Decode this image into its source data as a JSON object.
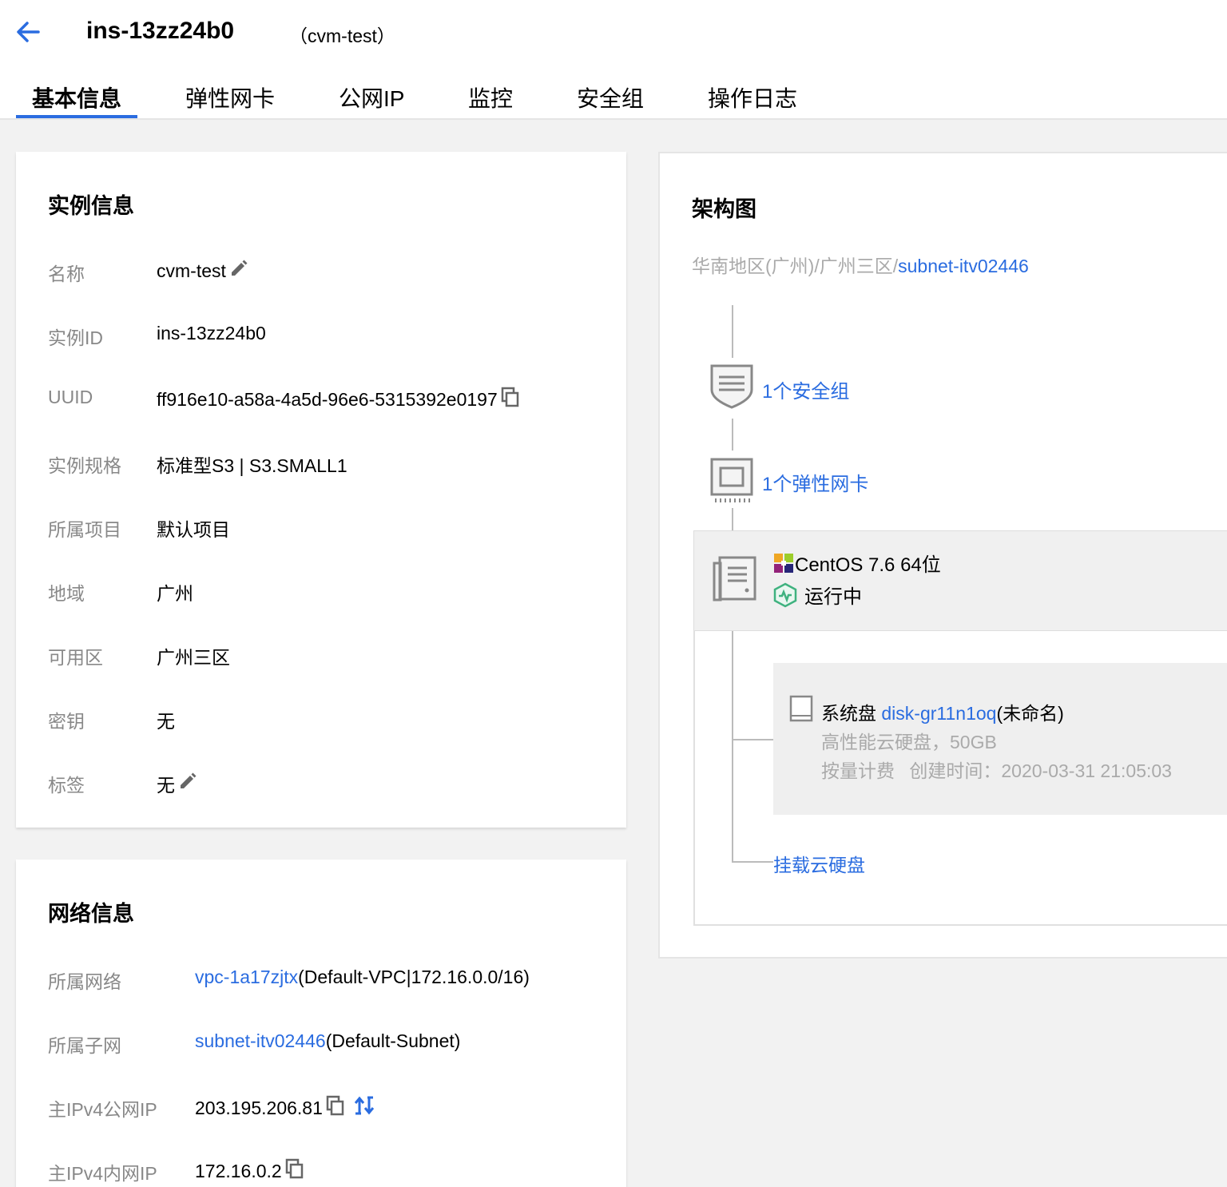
{
  "header": {
    "title": "ins-13zz24b0",
    "alias": "（cvm-test）"
  },
  "tabs": [
    {
      "label": "基本信息",
      "active": true
    },
    {
      "label": "弹性网卡",
      "active": false
    },
    {
      "label": "公网IP",
      "active": false
    },
    {
      "label": "监控",
      "active": false
    },
    {
      "label": "安全组",
      "active": false
    },
    {
      "label": "操作日志",
      "active": false
    }
  ],
  "instance_info": {
    "title": "实例信息",
    "rows": [
      {
        "label": "名称",
        "value": "cvm-test"
      },
      {
        "label": "实例ID",
        "value": "ins-13zz24b0"
      },
      {
        "label": "UUID",
        "value": "ff916e10-a58a-4a5d-96e6-5315392e0197"
      },
      {
        "label": "实例规格",
        "value": "标准型S3 | S3.SMALL1"
      },
      {
        "label": "所属项目",
        "value": "默认项目"
      },
      {
        "label": "地域",
        "value": "广州"
      },
      {
        "label": "可用区",
        "value": "广州三区"
      },
      {
        "label": "密钥",
        "value": "无"
      },
      {
        "label": "标签",
        "value": "无"
      }
    ]
  },
  "network_info": {
    "title": "网络信息",
    "rows": [
      {
        "label": "所属网络",
        "link": "vpc-1a17zjtx",
        "value": "(Default-VPC|172.16.0.0/16)"
      },
      {
        "label": "所属子网",
        "link": "subnet-itv02446",
        "value": "(Default-Subnet)"
      },
      {
        "label": "主IPv4公网IP",
        "value": "203.195.206.81"
      },
      {
        "label": "主IPv4内网IP",
        "value": "172.16.0.2"
      }
    ]
  },
  "architecture": {
    "title": "架构图",
    "crumb_text": "华南地区(广州)/广州三区/",
    "crumb_link": "subnet-itv02446",
    "security_group": "1个安全组",
    "eni": "1个弹性网卡",
    "os": "CentOS 7.6 64位",
    "status": "运行中",
    "disk": {
      "type_label": "系统盘",
      "id": "disk-gr11n1oq",
      "name": "(未命名)",
      "spec": "高性能云硬盘，50GB",
      "billing": "按量计费",
      "created_label": "创建时间：",
      "created": "2020-03-31 21:05:03"
    },
    "attach_disk": "挂载云硬盘"
  },
  "colors": {
    "accent": "#2a6ce0",
    "label_gray": "#888888",
    "status_green": "#3fb27f"
  }
}
